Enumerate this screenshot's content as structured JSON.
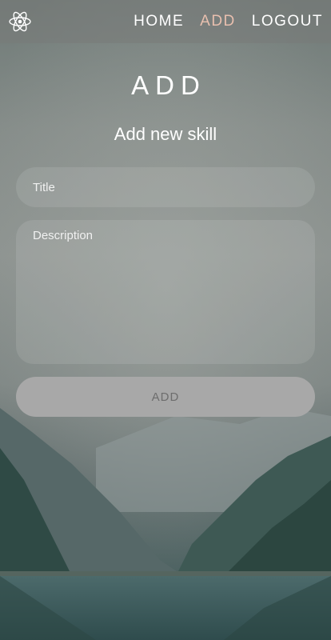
{
  "nav": {
    "logo_icon": "react-atom-icon",
    "links": [
      {
        "label": "HOME"
      },
      {
        "label": "ADD",
        "active": true
      },
      {
        "label": "LOGOUT"
      }
    ],
    "active_color": "#e8bfae"
  },
  "main": {
    "title": "ADD",
    "subtitle": "Add new skill"
  },
  "form": {
    "title_placeholder": "Title",
    "title_value": "",
    "description_placeholder": "Description",
    "description_value": "",
    "submit_label": "ADD"
  }
}
